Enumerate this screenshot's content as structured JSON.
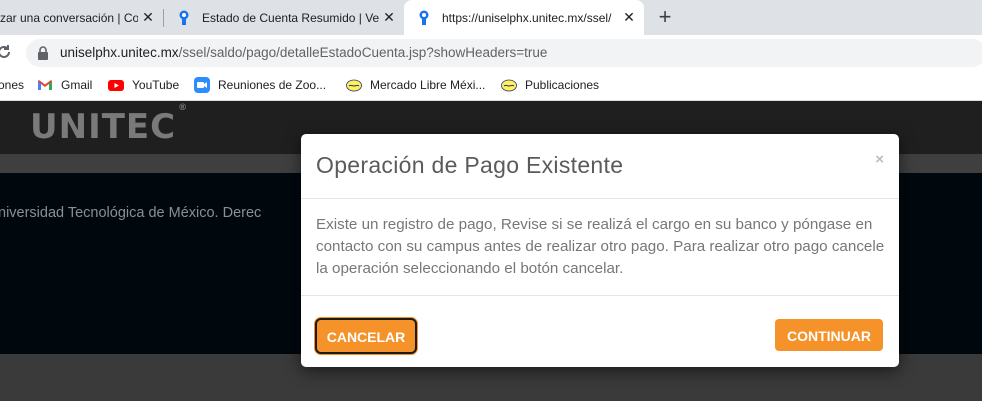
{
  "browser": {
    "tabs": [
      {
        "label": "zar una conversación | Co",
        "active": false
      },
      {
        "label": "Estado de Cuenta Resumido | Ver",
        "active": false
      },
      {
        "label": "https://uniselphx.unitec.mx/ssel/",
        "active": true
      }
    ],
    "url_host": "uniselphx.unitec.mx",
    "url_path": "/ssel/saldo/pago/detalleEstadoCuenta.jsp?showHeaders=true",
    "bookmarks": [
      {
        "label": "ones",
        "icon": "apps-icon"
      },
      {
        "label": "Gmail",
        "icon": "gmail-icon"
      },
      {
        "label": "YouTube",
        "icon": "youtube-icon"
      },
      {
        "label": "Reuniones de Zoo...",
        "icon": "zoom-icon"
      },
      {
        "label": "Mercado Libre Méxi...",
        "icon": "mercadolibre-icon"
      },
      {
        "label": "Publicaciones",
        "icon": "mercadolibre-icon"
      }
    ]
  },
  "site": {
    "logo": "UNITEC",
    "logo_mark": "®",
    "footer_text": "niversidad Tecnológica de México. Derec                                                                                                                              Col. El Parc"
  },
  "modal": {
    "title": "Operación de Pago Existente",
    "close": "×",
    "body": "Existe un registro de pago, Revise si se realizá el cargo en su banco y póngase en contacto con su campus antes de realizar otro pago. Para realizar otro pago cancele la operación seleccionando el botón cancelar.",
    "cancel_label": "CANCELAR",
    "continue_label": "CONTINUAR"
  },
  "colors": {
    "accent": "#f5922a",
    "header": "#1f1f1f",
    "footer": "#00080e"
  }
}
